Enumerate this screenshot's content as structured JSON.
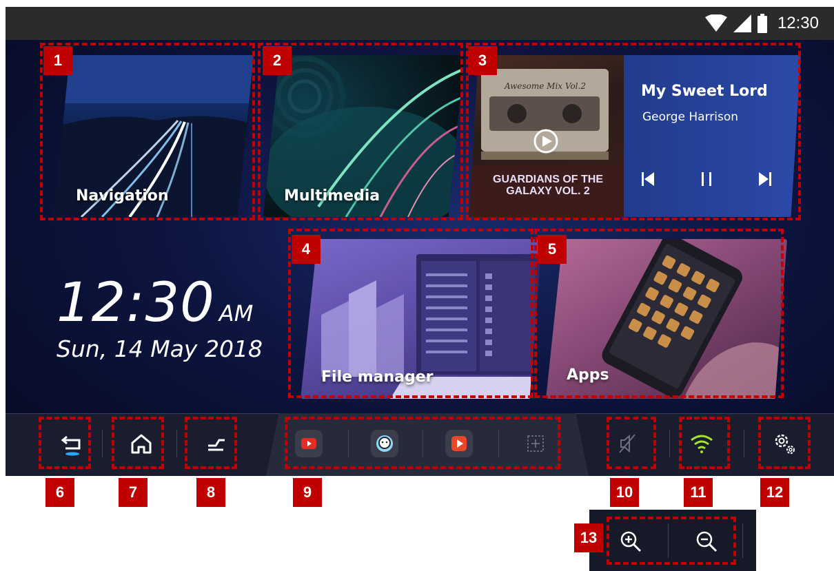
{
  "status_bar": {
    "time": "12:30",
    "icons": [
      "wifi-icon",
      "cellular-signal-icon",
      "battery-icon"
    ]
  },
  "tiles": {
    "navigation": {
      "label": "Navigation"
    },
    "multimedia": {
      "label": "Multimedia"
    },
    "music": {
      "title": "My Sweet Lord",
      "artist": "George Harrison",
      "album_art_text": "Awesome Mix Vol.2",
      "album_logo_text": "GUARDIANS OF THE GALAXY VOL. 2",
      "controls": [
        "previous-track-icon",
        "pause-icon",
        "next-track-icon"
      ]
    },
    "file_manager": {
      "label": "File manager"
    },
    "apps": {
      "label": "Apps"
    }
  },
  "clock": {
    "time": "12:30",
    "ampm": "AM",
    "date": "Sun, 14 May 2018"
  },
  "dock": {
    "left_buttons": [
      "back-icon",
      "home-icon",
      "recent-apps-icon"
    ],
    "quick_apps": [
      "youtube-app-icon",
      "waze-app-icon",
      "video-app-icon",
      "add-app-icon"
    ],
    "right_buttons": [
      "mute-icon",
      "wifi-icon",
      "settings-icon"
    ]
  },
  "zoom": {
    "buttons": [
      "zoom-in-icon",
      "zoom-out-icon"
    ]
  },
  "callouts": [
    "1",
    "2",
    "3",
    "4",
    "5",
    "6",
    "7",
    "8",
    "9",
    "10",
    "11",
    "12",
    "13"
  ],
  "colors": {
    "callout": "#c00000",
    "wifi_active": "#a7e22e",
    "back_accent": "#2aa7ff"
  }
}
